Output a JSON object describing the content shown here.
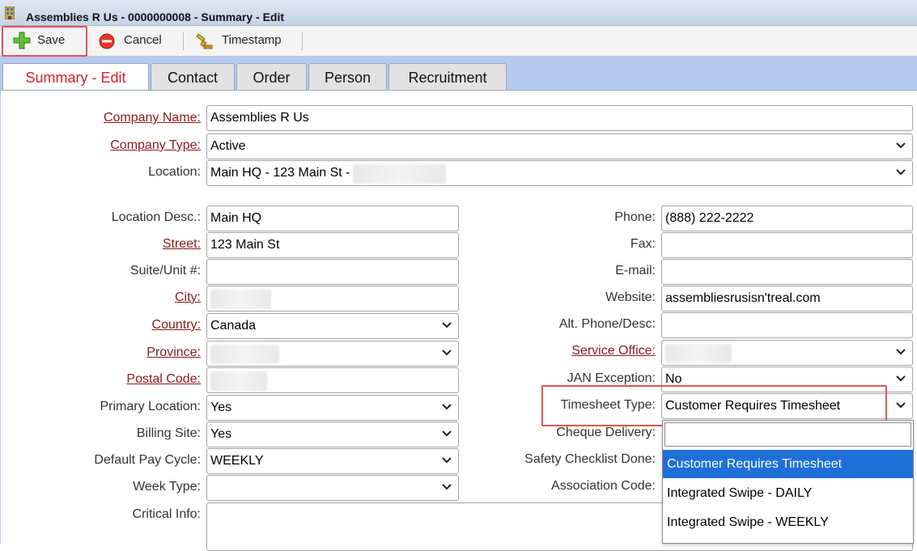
{
  "window": {
    "title": "Assemblies R Us - 0000000008 - Summary - Edit",
    "icon": "building-icon"
  },
  "toolbar": {
    "save_label": "Save",
    "cancel_label": "Cancel",
    "timestamp_label": "Timestamp"
  },
  "tabs": [
    {
      "label": "Summary - Edit",
      "active": true
    },
    {
      "label": "Contact"
    },
    {
      "label": "Order"
    },
    {
      "label": "Person"
    },
    {
      "label": "Recruitment"
    }
  ],
  "form": {
    "company_name": {
      "label": "Company Name:",
      "value": "Assemblies R Us"
    },
    "company_type": {
      "label": "Company Type:",
      "value": "Active"
    },
    "location": {
      "label": "Location:",
      "value": "Main HQ - 123 Main St -"
    },
    "location_desc": {
      "label": "Location Desc.:",
      "value": "Main HQ"
    },
    "street": {
      "label": "Street:",
      "value": "123 Main St"
    },
    "suite_unit": {
      "label": "Suite/Unit #:",
      "value": ""
    },
    "city": {
      "label": "City:",
      "value": ""
    },
    "country": {
      "label": "Country:",
      "value": "Canada"
    },
    "province": {
      "label": "Province:",
      "value": ""
    },
    "postal_code": {
      "label": "Postal Code:",
      "value": ""
    },
    "primary_location": {
      "label": "Primary Location:",
      "value": "Yes"
    },
    "billing_site": {
      "label": "Billing Site:",
      "value": "Yes"
    },
    "default_pay_cycle": {
      "label": "Default Pay Cycle:",
      "value": "WEEKLY"
    },
    "week_type": {
      "label": "Week Type:",
      "value": ""
    },
    "critical_info": {
      "label": "Critical Info:",
      "value": ""
    },
    "phone": {
      "label": "Phone:",
      "value": "(888) 222-2222"
    },
    "fax": {
      "label": "Fax:",
      "value": ""
    },
    "email": {
      "label": "E-mail:",
      "value": ""
    },
    "website": {
      "label": "Website:",
      "value": "assembliesrusisn'treal.com"
    },
    "alt_phone": {
      "label": "Alt. Phone/Desc:",
      "value": ""
    },
    "service_office": {
      "label": "Service Office:",
      "value": ""
    },
    "jan_exception": {
      "label": "JAN Exception:",
      "value": "No"
    },
    "timesheet_type": {
      "label": "Timesheet Type:",
      "value": "Customer Requires Timesheet"
    },
    "cheque_delivery": {
      "label": "Cheque Delivery:"
    },
    "safety_checklist": {
      "label": "Safety Checklist Done:"
    },
    "association_code": {
      "label": "Association Code:"
    }
  },
  "timesheet_dropdown": {
    "search_value": "",
    "options": [
      {
        "label": "Customer Requires Timesheet",
        "selected": true
      },
      {
        "label": "Integrated Swipe - DAILY"
      },
      {
        "label": "Integrated Swipe - WEEKLY"
      }
    ]
  },
  "colors": {
    "required_label": "#8b1a1a",
    "active_tab_text": "#d8232a",
    "tab_strip": "#b6c9ee",
    "highlight": "#e05555",
    "selected_option": "#1e6fd8"
  }
}
